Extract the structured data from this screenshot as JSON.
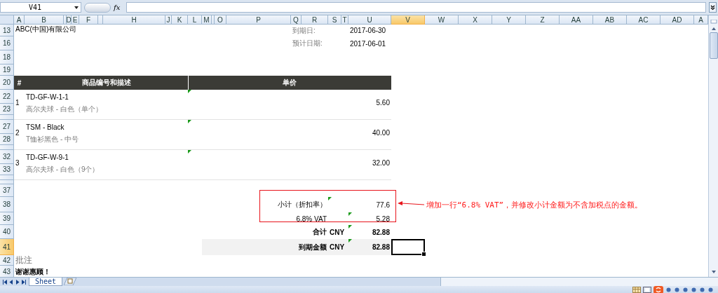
{
  "name_box": "V41",
  "function_label": "fx",
  "columns": [
    {
      "label": "A",
      "selected": false
    },
    {
      "label": "B",
      "selected": false
    },
    {
      "selected": false
    },
    {
      "label": "D",
      "selected": false
    },
    {
      "label": "E",
      "selected": false
    },
    {
      "label": "F",
      "selected": false
    },
    {
      "selected": false
    },
    {
      "label": "H",
      "selected": false
    },
    {
      "label": "J",
      "selected": false
    },
    {
      "label": "K",
      "selected": false
    },
    {
      "label": "L",
      "selected": false
    },
    {
      "label": "M",
      "selected": false
    },
    {
      "selected": false
    },
    {
      "label": "O",
      "selected": false
    },
    {
      "label": "P",
      "selected": false
    },
    {
      "label": "Q",
      "selected": false
    },
    {
      "label": "R",
      "selected": false
    },
    {
      "label": "S",
      "selected": false
    },
    {
      "label": "T",
      "selected": false
    },
    {
      "label": "U",
      "selected": false
    },
    {
      "label": "V",
      "selected": true
    },
    {
      "label": "W",
      "selected": false
    },
    {
      "label": "X",
      "selected": false
    },
    {
      "label": "Y",
      "selected": false
    },
    {
      "label": "Z",
      "selected": false
    },
    {
      "label": "AA",
      "selected": false
    },
    {
      "label": "AB",
      "selected": false
    },
    {
      "label": "AC",
      "selected": false
    },
    {
      "label": "AD",
      "selected": false
    },
    {
      "label": "A",
      "selected": false
    }
  ],
  "rows": [
    {
      "label": "13",
      "selected": false
    },
    {
      "label": "16",
      "selected": false
    },
    {
      "label": "18",
      "selected": false
    },
    {
      "label": "19",
      "selected": false
    },
    {
      "label": "20",
      "selected": false
    },
    {
      "label": "22",
      "selected": false
    },
    {
      "label": "23",
      "selected": false
    },
    {
      "label": "27",
      "selected": false
    },
    {
      "label": "28",
      "selected": false
    },
    {
      "label": "32",
      "selected": false
    },
    {
      "label": "33",
      "selected": false
    },
    {
      "label": "37",
      "selected": false
    },
    {
      "label": "38",
      "selected": false
    },
    {
      "label": "39",
      "selected": false
    },
    {
      "label": "40",
      "selected": false
    },
    {
      "label": "41",
      "selected": true
    },
    {
      "label": "42",
      "selected": false
    },
    {
      "label": "43",
      "selected": false
    }
  ],
  "company": "ABC(中国)有限公司",
  "dates": [
    {
      "label": "到期日:",
      "value": "2017-06-30"
    },
    {
      "label": "预计日期:",
      "value": "2017-06-01"
    }
  ],
  "items_table": {
    "columns": [
      "#",
      "商品编号和描述",
      "单价"
    ],
    "rows": [
      {
        "number": "1",
        "code": "TD-GF-W-1-1",
        "description": "高尔夫球 - 白色（单个）",
        "price": "5.60"
      },
      {
        "number": "2",
        "code": "TSM - Black",
        "description": "T恤衫黑色 - 中号",
        "price": "40.00"
      },
      {
        "number": "3",
        "code": "TD-GF-W-9-1",
        "description": "高尔夫球 - 白色（9个）",
        "price": "32.00"
      }
    ]
  },
  "totals": [
    {
      "kind": "plain",
      "label": "小计（折扣率）",
      "value": "77.6"
    },
    {
      "kind": "plain",
      "label": "6.8% VAT",
      "value": "5.28"
    },
    {
      "kind": "total",
      "label": "合计",
      "currency": "CNY",
      "value": "82.88"
    },
    {
      "kind": "due",
      "label": "到期金额",
      "currency": "CNY",
      "value": "82.88"
    }
  ],
  "annotation": "增加一行“6.8% VAT”，并修改小计金额为不含加税点的金额。",
  "notes": {
    "title": "批注",
    "text": "谢谢惠顾！"
  },
  "sheet_tabs": [
    {
      "label": "Sheet",
      "selected": true
    }
  ]
}
